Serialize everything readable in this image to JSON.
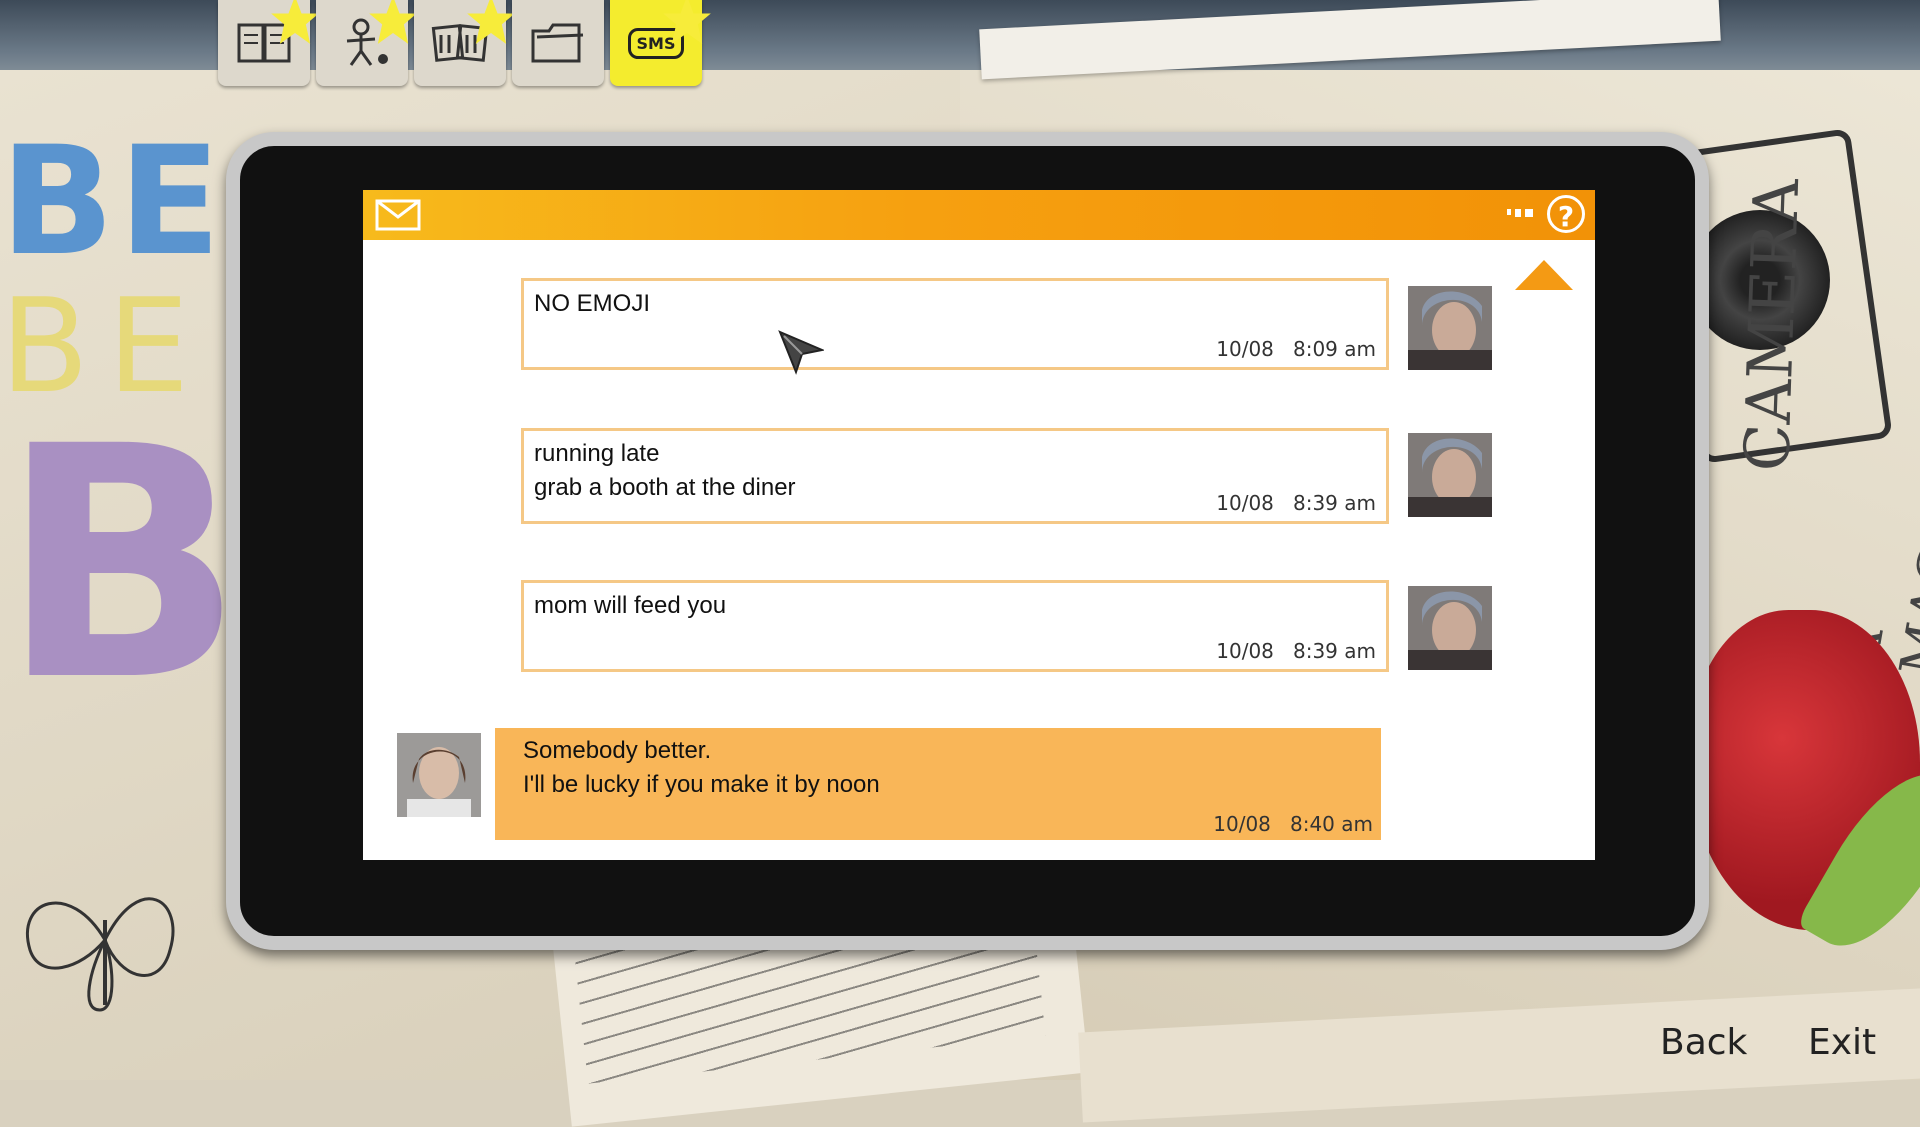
{
  "tabs": [
    {
      "name": "journal",
      "icon": "book-icon"
    },
    {
      "name": "characters",
      "icon": "stick-figure-icon"
    },
    {
      "name": "photos",
      "icon": "photos-icon"
    },
    {
      "name": "collectibles",
      "icon": "folder-icon"
    },
    {
      "name": "sms",
      "icon": "sms-icon",
      "label": "SMS",
      "active": true
    }
  ],
  "phone": {
    "messages": [
      {
        "text": "NO EMOJI",
        "date": "10/08",
        "time": "8:09 am",
        "sender": "chloe"
      },
      {
        "text": "running late\ngrab a booth at the diner",
        "date": "10/08",
        "time": "8:39 am",
        "sender": "chloe"
      },
      {
        "text": "mom will feed you",
        "date": "10/08",
        "time": "8:39 am",
        "sender": "chloe"
      },
      {
        "text": "Somebody better.\nI'll be lucky if you make it by noon",
        "date": "10/08",
        "time": "8:40 am",
        "sender": "max"
      }
    ]
  },
  "nav": {
    "back_label": "Back",
    "exit_label": "Exit"
  },
  "colors": {
    "header_orange": "#f6a010",
    "outgoing_bubble": "#f9b658",
    "bubble_border": "#f5c886",
    "sms_tab": "#f4ec2e"
  },
  "background_text": {
    "left_1": "BE",
    "left_2": "BE",
    "left_3": "BI",
    "right_1": "CAMERA",
    "right_2": "A MAGICIAN"
  }
}
